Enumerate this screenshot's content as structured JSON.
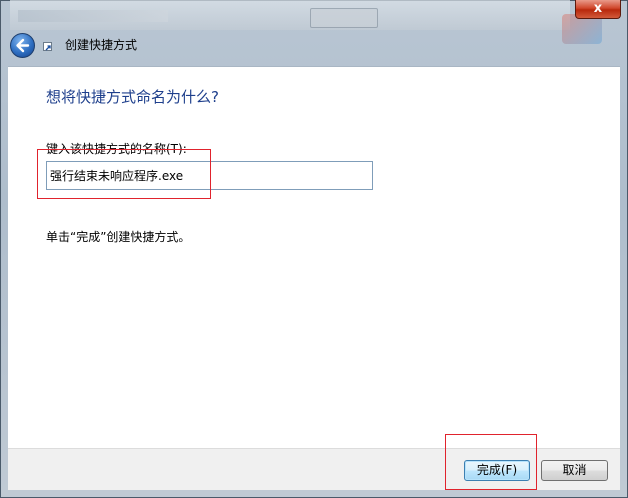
{
  "window": {
    "title": "创建快捷方式",
    "close_label": "x"
  },
  "main": {
    "heading": "想将快捷方式命名为什么?",
    "field_label": "键入该快捷方式的名称(T):",
    "name_value": "强行结束未响应程序.exe",
    "hint": "单击“完成”创建快捷方式。"
  },
  "footer": {
    "finish_label": "完成(F)",
    "cancel_label": "取消"
  },
  "icons": {
    "back": "back-arrow-icon",
    "shortcut": "shortcut-icon",
    "close": "close-icon"
  },
  "colors": {
    "heading": "#1e3f8c",
    "annotation": "#e0232d",
    "close_button": "#c8401f",
    "back_button": "#2e6fc2"
  }
}
